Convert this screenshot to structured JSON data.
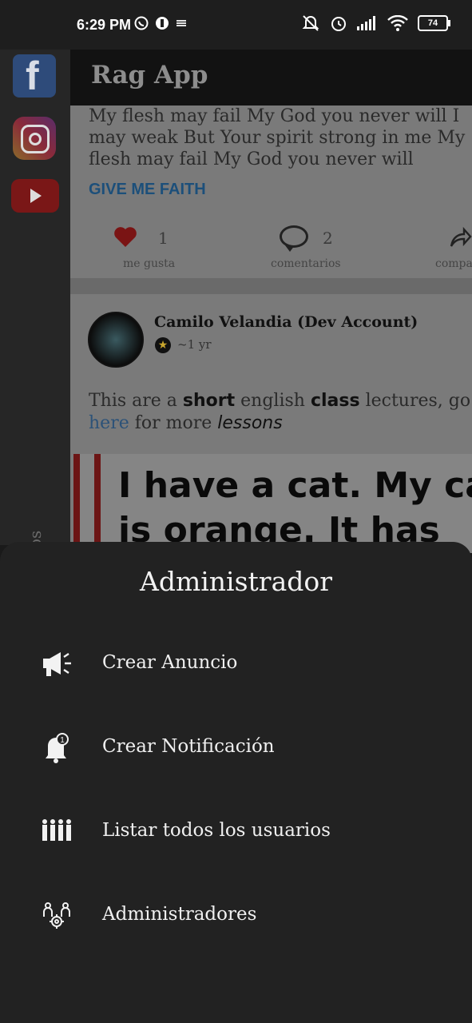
{
  "status_bar": {
    "time": "6:29 PM",
    "battery": "74"
  },
  "rail": {
    "vertical_label": "rios"
  },
  "app_bar": {
    "title": "Rag App"
  },
  "post1": {
    "text": "My flesh may fail My God you never will I may weak But Your spirit strong in me My flesh may fail My God you never will",
    "link": "GIVE ME FAITH",
    "likes": "1",
    "likes_label": "me gusta",
    "comments": "2",
    "comments_label": "comentarios",
    "share_label": "compartir"
  },
  "post2": {
    "author": "Camilo Velandia (Dev Account)",
    "time_ago": "~1 yr",
    "body_parts": [
      "This are a ",
      "short",
      " english ",
      "class",
      " lectures, go ",
      "here",
      " for more ",
      "lessons"
    ],
    "image_text_line1": "I have a cat. My cat",
    "image_text_line2": "is orange. It has"
  },
  "sheet": {
    "title": "Administrador",
    "items": [
      {
        "label": "Crear Anuncio",
        "icon": "megaphone-icon"
      },
      {
        "label": "Crear Notificación",
        "icon": "bell-icon"
      },
      {
        "label": "Listar todos los usuarios",
        "icon": "users-icon"
      },
      {
        "label": "Administradores",
        "icon": "admins-icon"
      }
    ]
  }
}
